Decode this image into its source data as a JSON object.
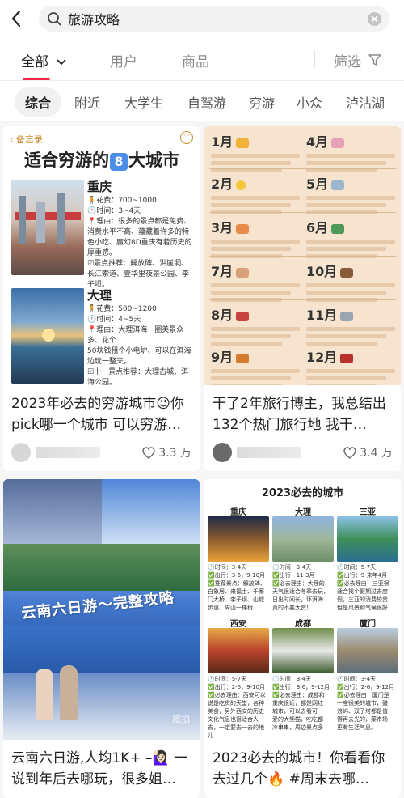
{
  "search": {
    "query": "旅游攻略"
  },
  "categories": [
    "全部",
    "用户",
    "商品"
  ],
  "filter_label": "筛选",
  "chips": [
    "综合",
    "附近",
    "大学生",
    "自驾游",
    "穷游",
    "小众",
    "泸沽湖"
  ],
  "colors": {
    "accent": "#ff2442",
    "chip_active_bg": "#f1f1f1"
  },
  "cards": [
    {
      "title": "2023年必去的穷游城市😉你pick哪一个城市 可以穷游…",
      "likes": "3.3 万",
      "cover": {
        "memo_label": "备忘录",
        "headline_pre": "适合穷游的",
        "headline_num": "8",
        "headline_post": "大城市",
        "cities": [
          {
            "name": "重庆",
            "lines": [
              "🧍花费：700~1000",
              "🕐时间：3~4天",
              "📍理由：很多的景点都是免费、",
              "消费水平不高、蕴藏着许多的特",
              "色小吃、魔幻8D重庆有着历史的",
              "厚重感。",
              "☑景点推荐：解放碑、洪崖洞、",
              "长江索道、壹华里夜景公园、李",
              "子坝。"
            ]
          },
          {
            "name": "大理",
            "lines": [
              "🧍花费：500~1200",
              "🕐时间：4~5天",
              "📍理由：大理洱海一圈美景众",
              "多、花个",
              "50块钱租个小电炉、可以在洱海",
              "边玩一整天。",
              "☑十一景点推荐：大理古城、洱",
              "海公园。"
            ]
          }
        ]
      }
    },
    {
      "title": "干了2年旅行博主，我总结出132个热门旅行地 我干…",
      "likes": "3.4 万",
      "cover": {
        "months": [
          "1月",
          "2月",
          "3月",
          "7月",
          "8月",
          "9月",
          "4月",
          "5月",
          "6月",
          "10月",
          "11月",
          "12月"
        ]
      }
    },
    {
      "title": "云南六日游,人均1K+ –🙋🏻‍♀️ 一说到年后去哪玩，很多姐…",
      "cover": {
        "overlay_text": "云南六日游～完整攻略",
        "corner_text": "旅拍"
      }
    },
    {
      "title": "2023必去的城市！你看看你去过几个🔥 #周末去哪…",
      "cover": {
        "heading": "2023必去的城市",
        "cities": [
          {
            "name": "重庆",
            "lines": [
              "🕐时间：3-4天",
              "✅出行：3-5，9-10月",
              "✅推荐景点：解放碑、",
              "白象居、来福士、千厮",
              "门大桥、李子坝、山城",
              "步道、周山一棵树"
            ]
          },
          {
            "name": "大理",
            "lines": [
              "🕐时间：3-4天",
              "✅出行：11-3月",
              "✅必去理由：大理的",
              "天气很适合冬季去玩，",
              "日出时间长，环洱海",
              "真的不要太赞！"
            ]
          },
          {
            "name": "三亚",
            "lines": [
              "🕐时间：5-7天",
              "✅出行：9-来年4月",
              "✅必去理由：三亚很",
              "适合找个假期过去度",
              "假，三亚的消费较贵，",
              "但是风景和气候很好"
            ]
          },
          {
            "name": "西安",
            "lines": [
              "🕐时间：5-7天",
              "✅出行：2-5，9-10月",
              "✅必去理由：西安可以",
              "说是吃货的天堂，各种",
              "美食，另外西安的历史",
              "文化气息也很适合人",
              "去，一定要去一去的地儿"
            ]
          },
          {
            "name": "成都",
            "lines": [
              "🕐时间：3-4天",
              "✅出行：3-6，9-12月",
              "✅必去理由：成都和",
              "重庆很近，都是网红",
              "城市，可以去看可",
              "爱的大熊猫，吃吃都",
              "冷串串，周边景点多"
            ]
          },
          {
            "name": "厦门",
            "lines": [
              "🕐时间：3-4天",
              "✅出行：2-6，9-12月",
              "✅必去理由：厦门是",
              "一座很美的城市，鼓",
              "浪屿、双子塔都是值",
              "得再去光的，菜市场",
              "更有生活气息。"
            ]
          }
        ]
      }
    }
  ]
}
